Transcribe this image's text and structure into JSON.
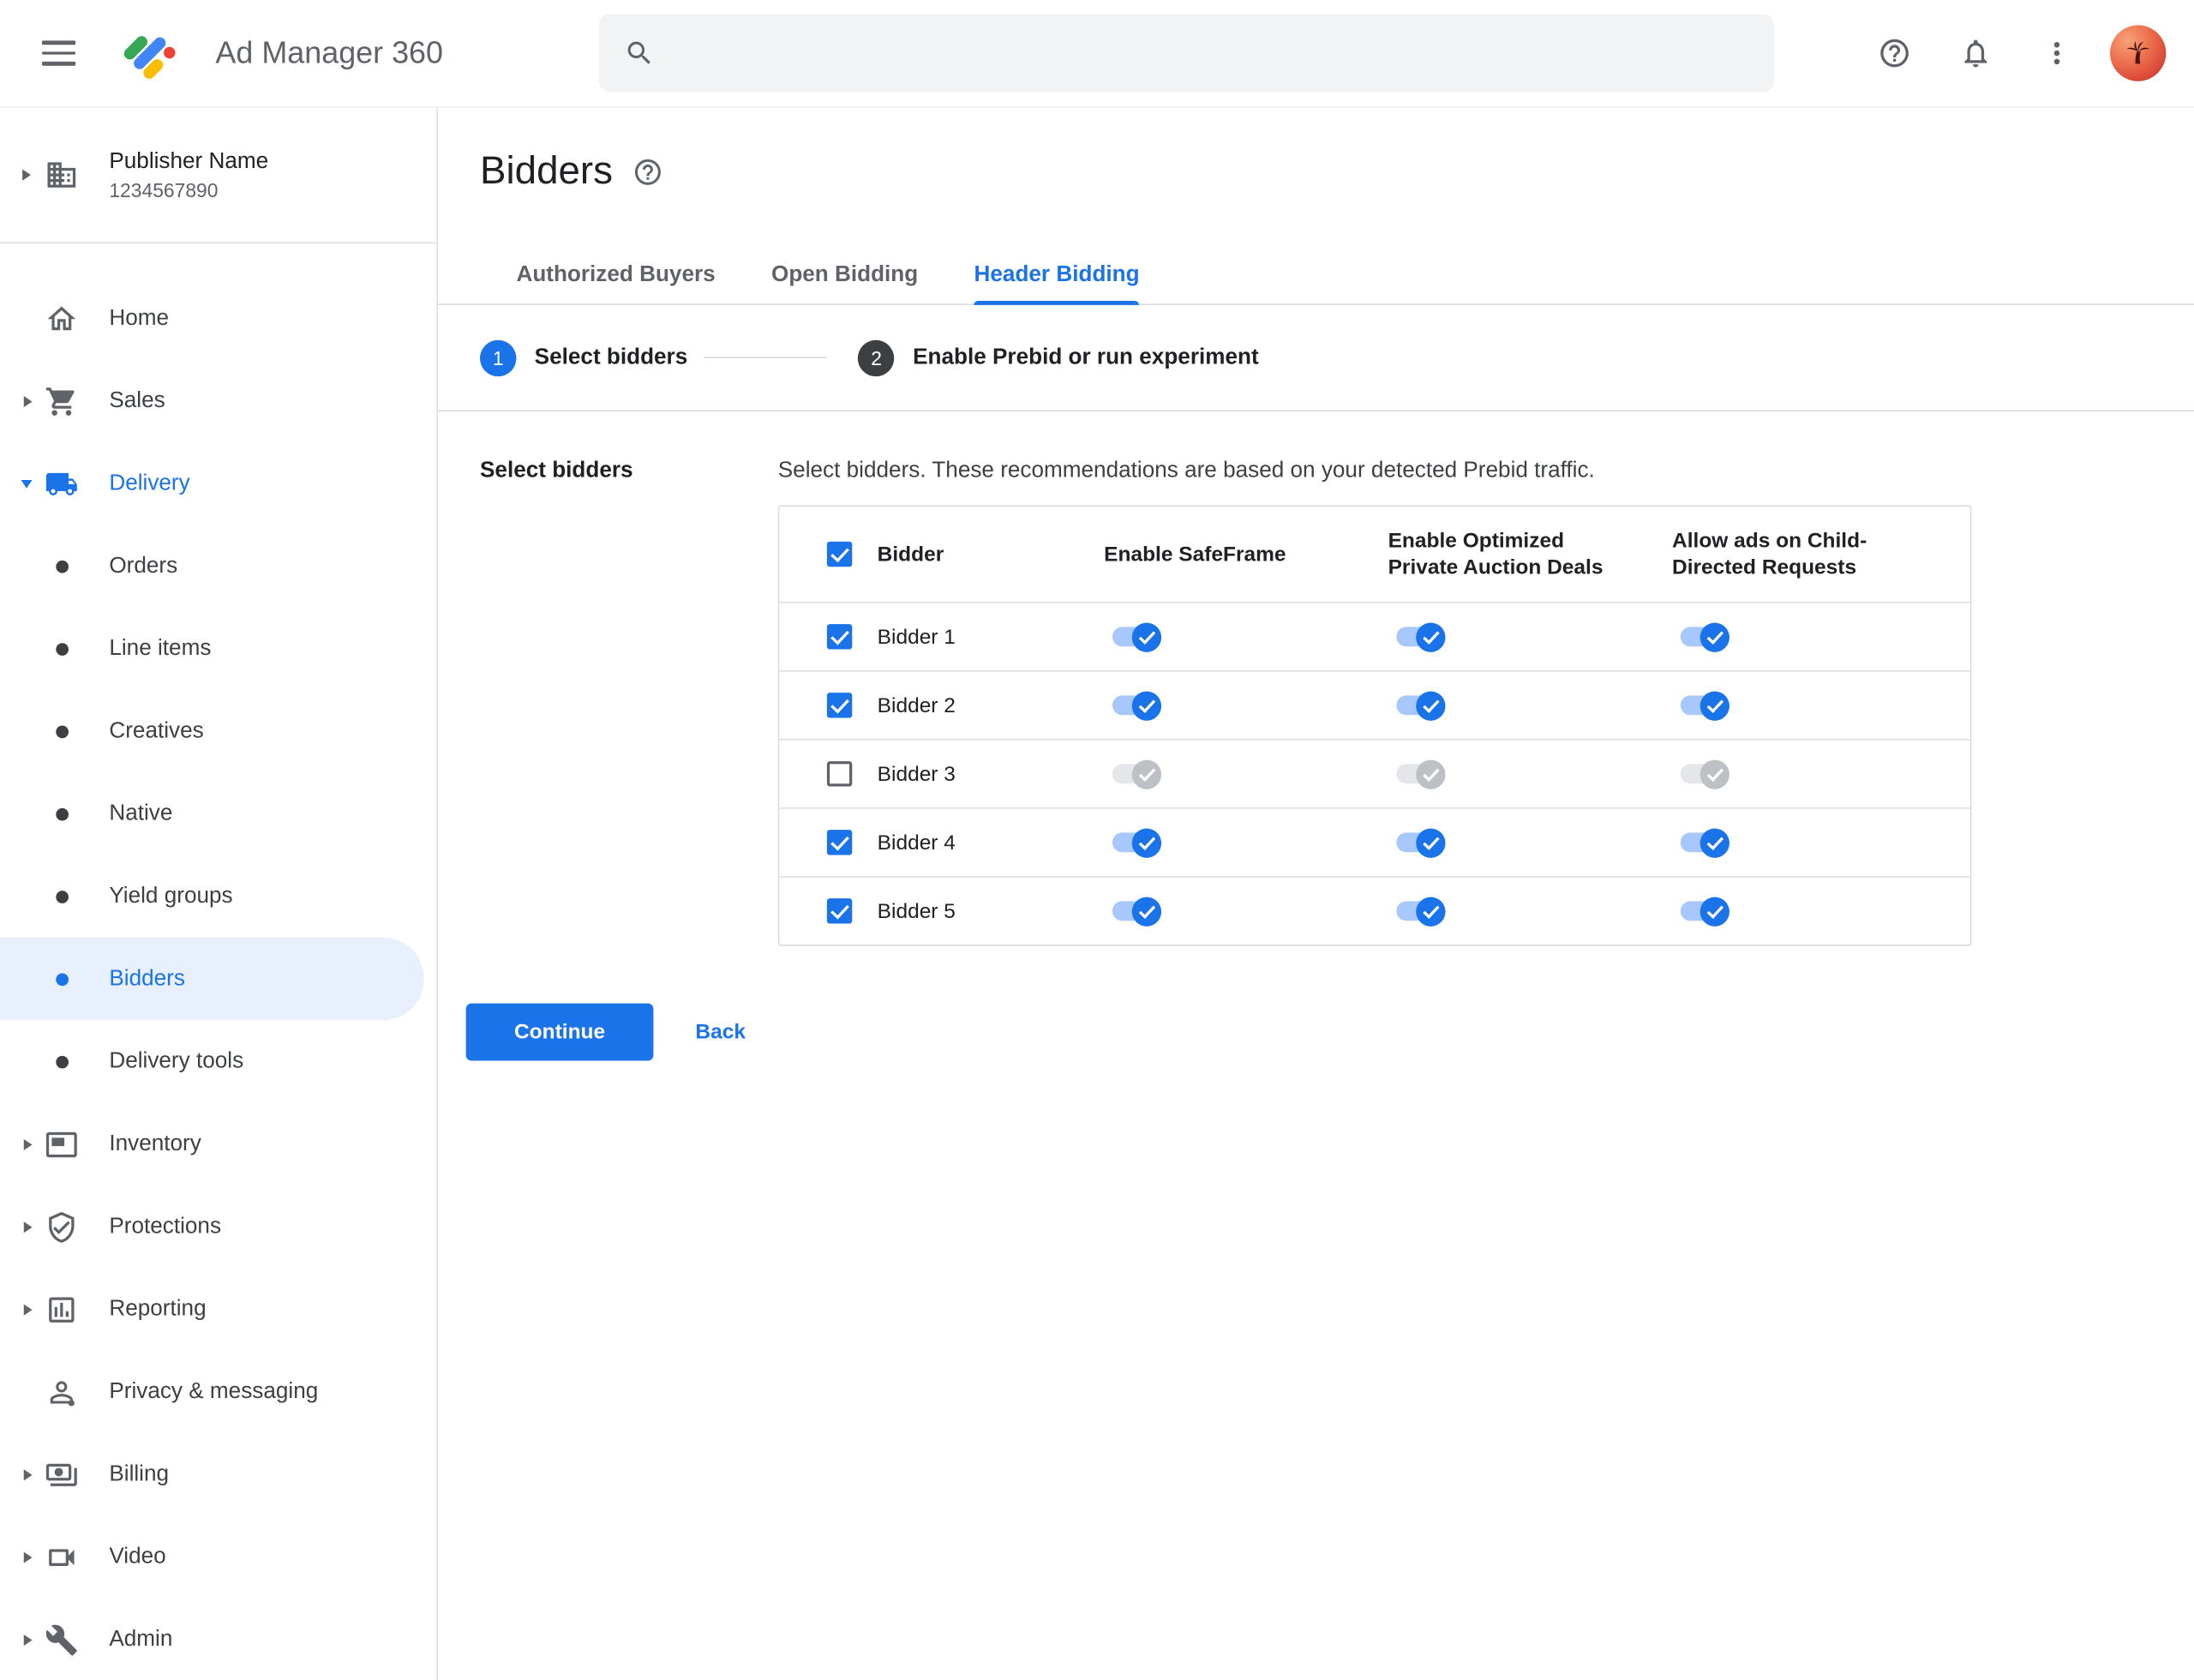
{
  "colors": {
    "accent": "#1a73e8",
    "accent_light": "#a8c7fa",
    "selected_bg": "#e8f0fe",
    "text_primary": "#202124",
    "text_secondary": "#5f6368",
    "border": "#dadce0",
    "row_border": "#e0e0e0",
    "search_bg": "#f1f3f4",
    "toggle_off_track": "#e4e6e9",
    "toggle_off_knob": "#bdc1c6",
    "step_inactive": "#3c4043",
    "logo_blue": "#4285f4",
    "logo_green": "#34a853",
    "logo_yellow": "#fbbc04",
    "logo_red": "#ea4335"
  },
  "header": {
    "app_name": "Ad Manager 360",
    "menu_icon": "hamburger-icon",
    "logo_icon": "ad-manager-logo",
    "search": {
      "placeholder": "",
      "value": "",
      "icon": "search-icon"
    },
    "action_icons": [
      "help-icon",
      "notifications-icon",
      "more-vert-icon",
      "avatar"
    ]
  },
  "sidebar": {
    "publisher": {
      "name": "Publisher Name",
      "id": "1234567890",
      "icon": "building-icon",
      "expandable": true
    },
    "items": [
      {
        "label": "Home",
        "type": "top",
        "icon": "home",
        "arrow": "none"
      },
      {
        "label": "Sales",
        "type": "top",
        "icon": "cart",
        "arrow": "right"
      },
      {
        "label": "Delivery",
        "type": "top",
        "icon": "truck",
        "arrow": "down",
        "active": true
      },
      {
        "label": "Orders",
        "type": "sub"
      },
      {
        "label": "Line items",
        "type": "sub"
      },
      {
        "label": "Creatives",
        "type": "sub"
      },
      {
        "label": "Native",
        "type": "sub"
      },
      {
        "label": "Yield groups",
        "type": "sub"
      },
      {
        "label": "Bidders",
        "type": "sub",
        "selected": true
      },
      {
        "label": "Delivery tools",
        "type": "sub"
      },
      {
        "label": "Inventory",
        "type": "top",
        "icon": "inventory",
        "arrow": "right"
      },
      {
        "label": "Protections",
        "type": "top",
        "icon": "shield",
        "arrow": "right"
      },
      {
        "label": "Reporting",
        "type": "top",
        "icon": "report",
        "arrow": "right"
      },
      {
        "label": "Privacy & messaging",
        "type": "top",
        "icon": "privacy",
        "arrow": "none"
      },
      {
        "label": "Billing",
        "type": "top",
        "icon": "billing",
        "arrow": "right"
      },
      {
        "label": "Video",
        "type": "top",
        "icon": "video",
        "arrow": "right"
      },
      {
        "label": "Admin",
        "type": "top",
        "icon": "admin",
        "arrow": "right"
      }
    ]
  },
  "main": {
    "title": "Bidders",
    "title_help_icon": "help-icon",
    "tabs": [
      {
        "label": "Authorized Buyers",
        "active": false
      },
      {
        "label": "Open Bidding",
        "active": false
      },
      {
        "label": "Header Bidding",
        "active": true
      }
    ],
    "stepper": [
      {
        "number": "1",
        "label": "Select bidders",
        "current": true
      },
      {
        "number": "2",
        "label": "Enable Prebid or run experiment",
        "current": false
      }
    ],
    "section_label": "Select bidders",
    "instruction": "Select bidders. These recommendations are based on your detected Prebid traffic.",
    "table": {
      "select_all_checked": true,
      "columns": [
        "Bidder",
        "Enable SafeFrame",
        "Enable Optimized Private Auction Deals",
        "Allow ads on Child-Directed Requests"
      ],
      "rows": [
        {
          "name": "Bidder 1",
          "checked": true,
          "safeframe": true,
          "optimized": true,
          "child_directed": true
        },
        {
          "name": "Bidder 2",
          "checked": true,
          "safeframe": true,
          "optimized": true,
          "child_directed": true
        },
        {
          "name": "Bidder 3",
          "checked": false,
          "safeframe": false,
          "optimized": false,
          "child_directed": false
        },
        {
          "name": "Bidder 4",
          "checked": true,
          "safeframe": true,
          "optimized": true,
          "child_directed": true
        },
        {
          "name": "Bidder 5",
          "checked": true,
          "safeframe": true,
          "optimized": true,
          "child_directed": true
        }
      ]
    },
    "continue_label": "Continue",
    "back_label": "Back"
  }
}
